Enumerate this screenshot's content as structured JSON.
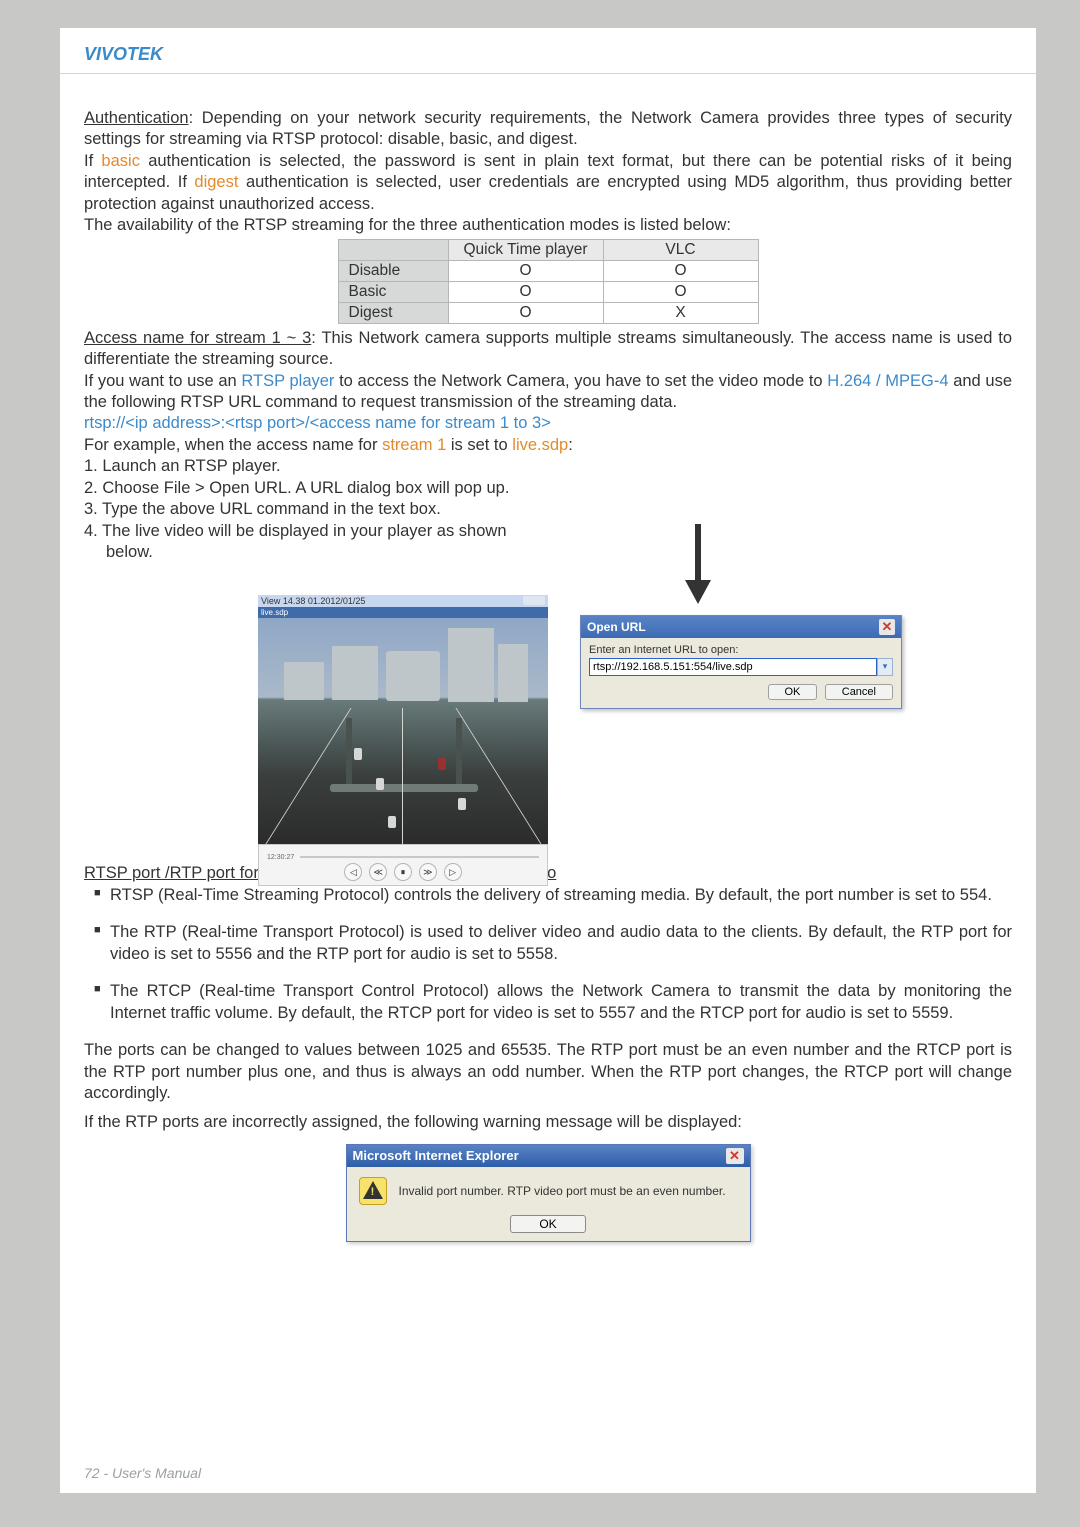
{
  "brand": "VIVOTEK",
  "para1": {
    "auth_u": "Authentication",
    "auth_rest": ": Depending on your network security requirements, the Network Camera provides three types of security settings for streaming via RTSP protocol: disable, basic, and digest.",
    "line2a": "If ",
    "basic": "basic",
    "line2b": " authentication is selected, the password is sent in plain text format, but there can be potential risks of it being intercepted. If ",
    "digest": "digest",
    "line2c": " authentication is selected, user credentials are encrypted using MD5 algorithm, thus providing better protection against unauthorized access.",
    "line3": "The availability of the RTSP streaming for the three authentication modes is listed below:"
  },
  "tbl": {
    "h1": "Quick Time player",
    "h2": "VLC",
    "r1": "Disable",
    "r2": "Basic",
    "r3": "Digest",
    "o": "O",
    "x": "X"
  },
  "para2": {
    "access_u": "Access name for stream 1 ~ 3",
    "access_rest": ": This Network camera supports multiple streams simultaneously. The access name is used to differentiate the streaming source.",
    "l2a": "If you want to use an ",
    "rtsp": "RTSP player",
    "l2b": " to access the Network Camera, you have to set the video mode to ",
    "h264": "H.264 / MPEG-4",
    "l2c": " and use the following RTSP URL command to request transmission of the streaming data.",
    "url": "rtsp://<ip address>:<rtsp port>/<access name for stream 1 to 3>",
    "l3a": "For example, when the access name for ",
    "s1": "stream 1",
    "l3b": " is set to ",
    "sdp": "live.sdp",
    "l3c": ":",
    "s_1": "1. Launch an RTSP player.",
    "s_2": "2. Choose File > Open URL. A URL dialog box will pop up.",
    "s_3": "3. Type the above URL command in the text box.",
    "s_4a": "4. The live video will be displayed in your player as shown",
    "s_4b": "below."
  },
  "player": {
    "url_text": "View  14.38 01.2012/01/25",
    "title": "live.sdp"
  },
  "dialog": {
    "title": "Open URL",
    "label": "Enter an Internet URL to open:",
    "value": "rtsp://192.168.5.151:554/live.sdp",
    "ok": "OK",
    "cancel": "Cancel"
  },
  "sect2_heading": "RTSP port /RTP port for video, audio/ RTCP port for video, audio",
  "li1": "RTSP (Real-Time Streaming Protocol) controls the delivery of streaming media. By default, the port number is set to 554.",
  "li2": "The RTP (Real-time Transport Protocol) is used to deliver video and audio data to the clients. By default, the RTP port for video is set to 5556 and the RTP port for audio is set to 5558.",
  "li3": "The RTCP (Real-time Transport Control Protocol) allows the Network Camera to transmit the data by monitoring the Internet traffic volume. By default, the RTCP port for video is set to 5557 and the RTCP port for audio is set to 5559.",
  "para3": "The ports can be changed to values between 1025 and 65535. The RTP port must be an even number and the RTCP port is the RTP port number plus one, and thus is always an odd number. When the RTP port changes, the RTCP port will change accordingly.",
  "para4": "If the RTP ports are incorrectly assigned, the following warning message will be displayed:",
  "warn": {
    "title": "Microsoft Internet Explorer",
    "msg": "Invalid port number. RTP video port must be an even number.",
    "ok": "OK"
  },
  "footer": "72 - User's Manual"
}
